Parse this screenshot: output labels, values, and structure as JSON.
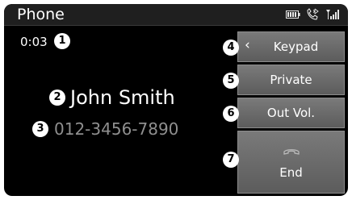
{
  "header": {
    "title": "Phone",
    "icons": [
      "battery-icon",
      "bluetooth-phone-icon",
      "signal-strength-icon"
    ]
  },
  "call": {
    "duration": "0:03",
    "caller_name": "John Smith",
    "caller_number": "012-3456-7890"
  },
  "markers": [
    "1",
    "2",
    "3",
    "4",
    "5",
    "6",
    "7"
  ],
  "buttons": {
    "keypad": "Keypad",
    "private": "Private",
    "out_vol": "Out Vol.",
    "end": "End"
  },
  "colors": {
    "background": "#000000",
    "button": "#6b6b6b",
    "number_text": "#8f8f8f"
  }
}
